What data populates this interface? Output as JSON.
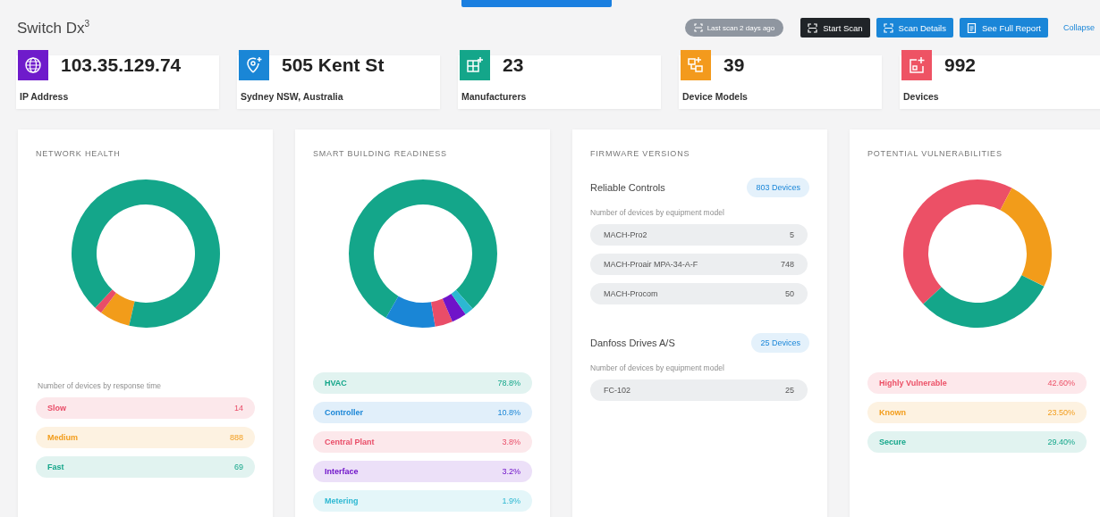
{
  "header": {
    "title": "Switch Dx$^{3}$",
    "last_scan": "Last scan 2 days ago",
    "buttons": [
      {
        "label": "Start Scan",
        "kind": "start"
      },
      {
        "label": "Scan Details",
        "kind": "details"
      },
      {
        "label": "See Full Report",
        "kind": "report"
      }
    ],
    "collapse": "Collapse"
  },
  "stats": [
    {
      "value": "103.35.129.74",
      "label": "IP Address",
      "kind": "ip",
      "color": "#6f1bcb"
    },
    {
      "value": "505 Kent St",
      "label": "Sydney NSW, Australia",
      "kind": "location",
      "color": "#1a86d6"
    },
    {
      "value": "23",
      "label": "Manufacturers",
      "kind": "manufacturers",
      "color": "#14a68a"
    },
    {
      "value": "39",
      "label": "Device Models",
      "kind": "models",
      "color": "#f39a1d"
    },
    {
      "value": "992",
      "label": "Devices",
      "kind": "devices",
      "color": "#ee5364"
    }
  ],
  "cards": [
    {
      "kind": "donut-picture",
      "title": "NETWORK HEALTH",
      "caption": "Number of devices by response time",
      "legend": [
        {
          "label": "Slow",
          "value": "14",
          "color": "#e94d68"
        },
        {
          "label": "Medium",
          "value": "888",
          "color": "#f29c1a"
        },
        {
          "label": "Fast",
          "value": "69",
          "color": "#14a68a"
        }
      ]
    },
    {
      "kind": "donut-chart",
      "title": "SMART BUILDING READINESS",
      "chart_data": {
        "type": "donut",
        "categories": [
          "HVAC",
          "Controller",
          "Central Plant",
          "Interface",
          "Metering"
        ],
        "values": [
          78.8,
          10.8,
          3.8,
          3.2,
          1.9
        ]
      },
      "legend": [
        {
          "value": "78.8%",
          "color": "#14a68a"
        },
        {
          "value": "10.8%",
          "color": "#1a86d6"
        },
        {
          "value": "3.8%",
          "color": "#e94d68"
        },
        {
          "value": "3.2%",
          "color": "#6f13c9"
        },
        {
          "value": "1.9%",
          "color": "#2cb8d2"
        }
      ]
    },
    {
      "kind": "firmware",
      "title": "FIRMWARE VERSIONS",
      "groups": [
        {
          "name": "Reliable Controls",
          "badge": "803 Devices",
          "caption": "Number of devices by equipment model",
          "models": [
            {
              "name": "MACH-Pro2",
              "count": "5"
            },
            {
              "name": "MACH-Proair MPA-34-A-F",
              "count": "748"
            },
            {
              "name": "MACH-Procom",
              "count": "50"
            }
          ]
        },
        {
          "name": "Danfoss Drives A/S",
          "badge": "25 Devices",
          "caption": "Number of devices by equipment model",
          "models": [
            {
              "name": "FC-102",
              "count": "25"
            }
          ]
        }
      ]
    },
    {
      "kind": "donut-chart",
      "title": "POTENTIAL VULNERABILITIES",
      "chart_data": {
        "type": "donut",
        "categories": [
          "Highly Vulnerable",
          "Known",
          "Secure"
        ],
        "values": [
          44.61,
          24.61,
          30.78
        ]
      },
      "legend": [
        {
          "value": "42.60%",
          "color": "#ec5066"
        },
        {
          "value": "23.50%",
          "color": "#f29c1a"
        },
        {
          "value": "29.40%",
          "color": "#14a68a"
        }
      ]
    }
  ]
}
